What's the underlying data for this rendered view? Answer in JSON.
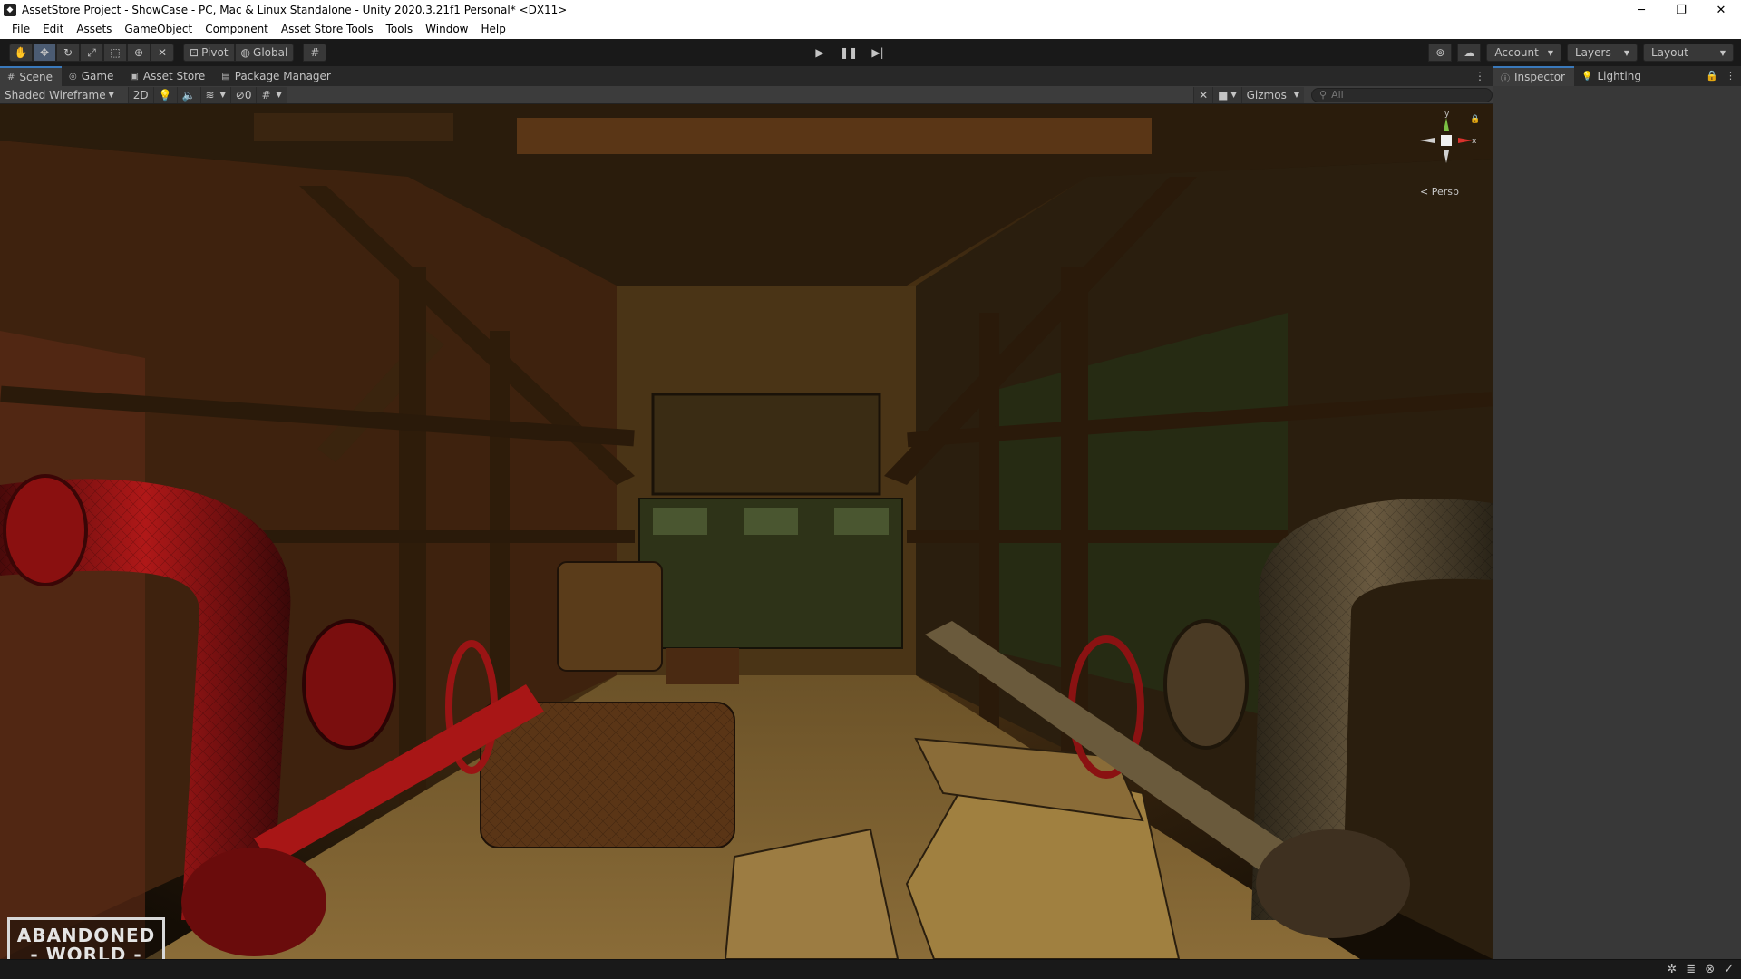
{
  "window": {
    "title": "AssetStore Project - ShowCase - PC, Mac & Linux Standalone - Unity 2020.3.21f1 Personal* <DX11>",
    "minimize": "─",
    "maximize": "❐",
    "close": "✕"
  },
  "menu": [
    "File",
    "Edit",
    "Assets",
    "GameObject",
    "Component",
    "Asset Store Tools",
    "Tools",
    "Window",
    "Help"
  ],
  "toolbar": {
    "tools": [
      "hand-tool",
      "move-tool",
      "rotate-tool",
      "scale-tool",
      "rect-tool",
      "transform-tool",
      "custom-tool"
    ],
    "active_tool": "move-tool",
    "pivot_label": "Pivot",
    "global_label": "Global",
    "account_label": "Account",
    "layers_label": "Layers",
    "layout_label": "Layout"
  },
  "tabs": [
    {
      "label": "Scene",
      "icon": "scene-icon",
      "active": true
    },
    {
      "label": "Game",
      "icon": "game-icon",
      "active": false
    },
    {
      "label": "Asset Store",
      "icon": "asset-store-icon",
      "active": false
    },
    {
      "label": "Package Manager",
      "icon": "package-icon",
      "active": false
    }
  ],
  "scene_toolbar": {
    "draw_mode": "Shaded Wireframe",
    "mode_2d": "2D",
    "hidden_count": "0",
    "gizmos_label": "Gizmos",
    "search_placeholder": "All"
  },
  "viewport": {
    "projection": "< Persp",
    "gizmo_y": "y",
    "gizmo_x": "x",
    "logo_line1": "ABANDONED",
    "logo_line2": "- WORLD -"
  },
  "right_panel": {
    "tabs": [
      {
        "label": "Inspector",
        "icon": "info-icon",
        "active": true
      },
      {
        "label": "Lighting",
        "icon": "lightbulb-icon",
        "active": false
      }
    ]
  }
}
